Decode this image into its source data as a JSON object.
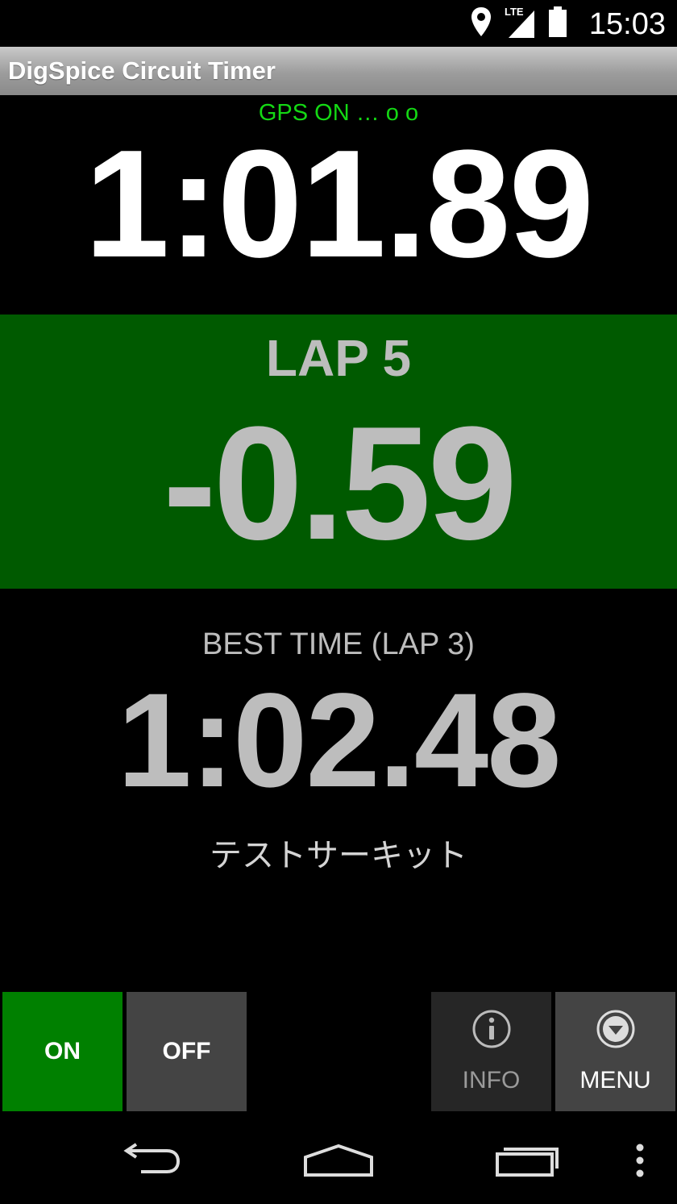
{
  "status_bar": {
    "time": "15:03",
    "network_label": "LTE",
    "icons": [
      "location-pin-icon",
      "lte-signal-icon",
      "battery-icon"
    ]
  },
  "app": {
    "title": "DigSpice Circuit Timer"
  },
  "timer": {
    "gps_status": "GPS ON … o o",
    "current_time": "1:01.89",
    "lap_label": "LAP 5",
    "delta": "-0.59",
    "best_label": "BEST TIME (LAP 3)",
    "best_time": "1:02.48",
    "circuit_name": "テストサーキット"
  },
  "buttons": {
    "on_label": "ON",
    "off_label": "OFF",
    "info_label": "INFO",
    "menu_label": "MENU"
  },
  "nav": {
    "icons": [
      "back-icon",
      "home-icon",
      "recents-icon",
      "overflow-icon"
    ]
  },
  "colors": {
    "gps_green": "#14d814",
    "lap_panel_green": "#005a00",
    "on_button_green": "#008000",
    "secondary_text_gray": "#bdbdbd"
  }
}
